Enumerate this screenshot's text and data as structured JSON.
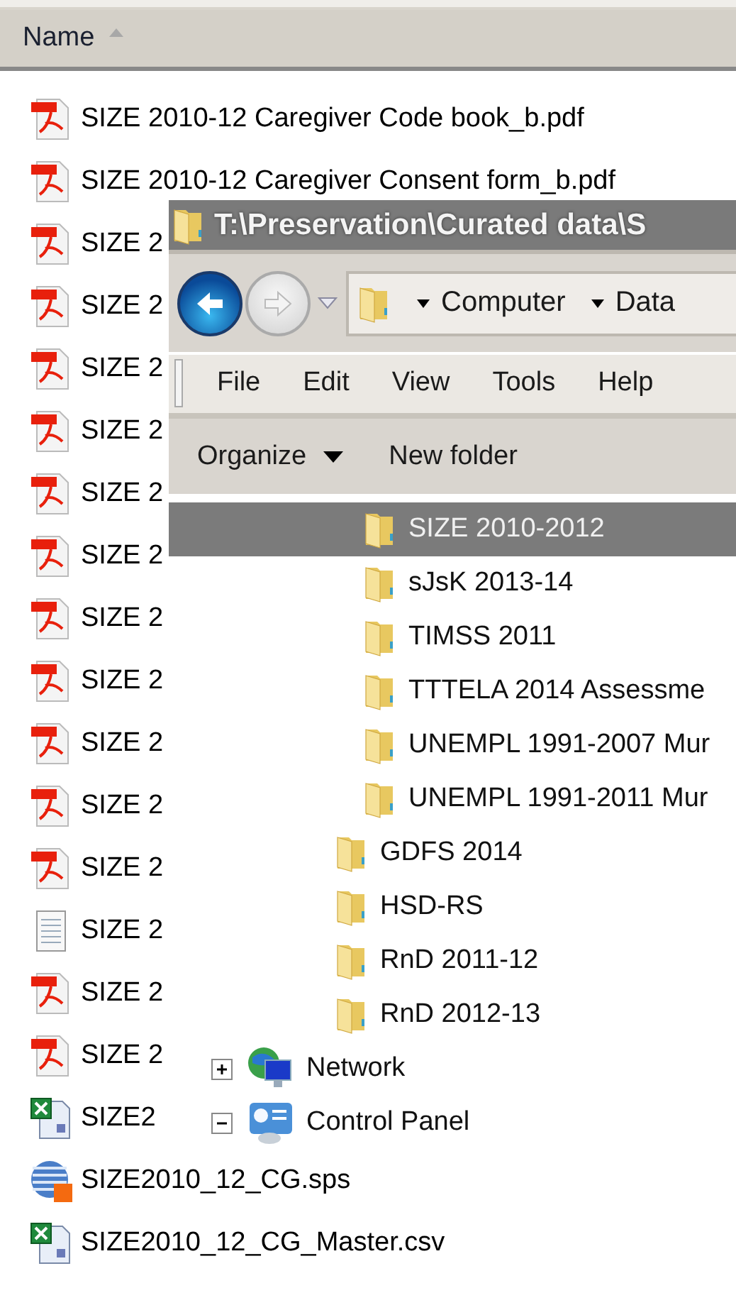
{
  "header": {
    "column": "Name",
    "sort_ascending": true
  },
  "files": [
    {
      "kind": "pdf",
      "name": "SIZE 2010-12 Caregiver Code book_b.pdf"
    },
    {
      "kind": "pdf",
      "name": "SIZE 2010-12 Caregiver Consent form_b.pdf"
    },
    {
      "kind": "pdf",
      "name": "SIZE 2"
    },
    {
      "kind": "pdf",
      "name": "SIZE 2"
    },
    {
      "kind": "pdf",
      "name": "SIZE 2"
    },
    {
      "kind": "pdf",
      "name": "SIZE 2"
    },
    {
      "kind": "pdf",
      "name": "SIZE 2"
    },
    {
      "kind": "pdf",
      "name": "SIZE 2"
    },
    {
      "kind": "pdf",
      "name": "SIZE 2"
    },
    {
      "kind": "pdf",
      "name": "SIZE 2"
    },
    {
      "kind": "pdf",
      "name": "SIZE 2"
    },
    {
      "kind": "pdf",
      "name": "SIZE 2"
    },
    {
      "kind": "pdf",
      "name": "SIZE 2"
    },
    {
      "kind": "text",
      "name": "SIZE 2"
    },
    {
      "kind": "pdf",
      "name": "SIZE 2"
    },
    {
      "kind": "pdf",
      "name": "SIZE 2"
    },
    {
      "kind": "excel",
      "name": "SIZE2"
    },
    {
      "kind": "syntax",
      "name": "SIZE2010_12_CG.sps"
    },
    {
      "kind": "excel",
      "name": "SIZE2010_12_CG_Master.csv"
    }
  ],
  "dialog": {
    "title": "T:\\Preservation\\Curated data\\S",
    "nav": {
      "back_enabled": true,
      "forward_enabled": false
    },
    "address": [
      "Computer",
      "Data"
    ],
    "menu": [
      "File",
      "Edit",
      "View",
      "Tools",
      "Help"
    ],
    "toolbar": [
      {
        "kind": "menu",
        "label": "Organize"
      },
      {
        "kind": "button",
        "label": "New folder"
      }
    ],
    "tree": [
      {
        "children": [
          {
            "children": [
              {
                "kind": "folder",
                "label": "SIZE 2010-2012",
                "selected": true
              },
              {
                "kind": "folder",
                "label": "sJsK 2013-14",
                "selected": false
              },
              {
                "kind": "folder",
                "label": "TIMSS 2011",
                "selected": false
              },
              {
                "kind": "folder",
                "label": "TTTELA 2014 Assessme",
                "selected": false
              },
              {
                "kind": "folder",
                "label": "UNEMPL 1991-2007 Mur",
                "selected": false
              },
              {
                "kind": "folder",
                "label": "UNEMPL 1991-2011 Mur",
                "selected": false
              }
            ]
          },
          {
            "kind": "folder",
            "label": "GDFS 2014",
            "selected": false
          },
          {
            "kind": "folder",
            "label": "HSD-RS",
            "selected": false
          },
          {
            "kind": "folder",
            "label": "RnD 2011-12",
            "selected": false
          },
          {
            "kind": "folder",
            "label": "RnD 2012-13",
            "selected": false
          }
        ]
      },
      {
        "kind": "network",
        "label": "Network",
        "selected": false,
        "expanded": false
      },
      {
        "kind": "control-panel",
        "label": "Control Panel",
        "selected": false,
        "expanded": true
      }
    ]
  }
}
